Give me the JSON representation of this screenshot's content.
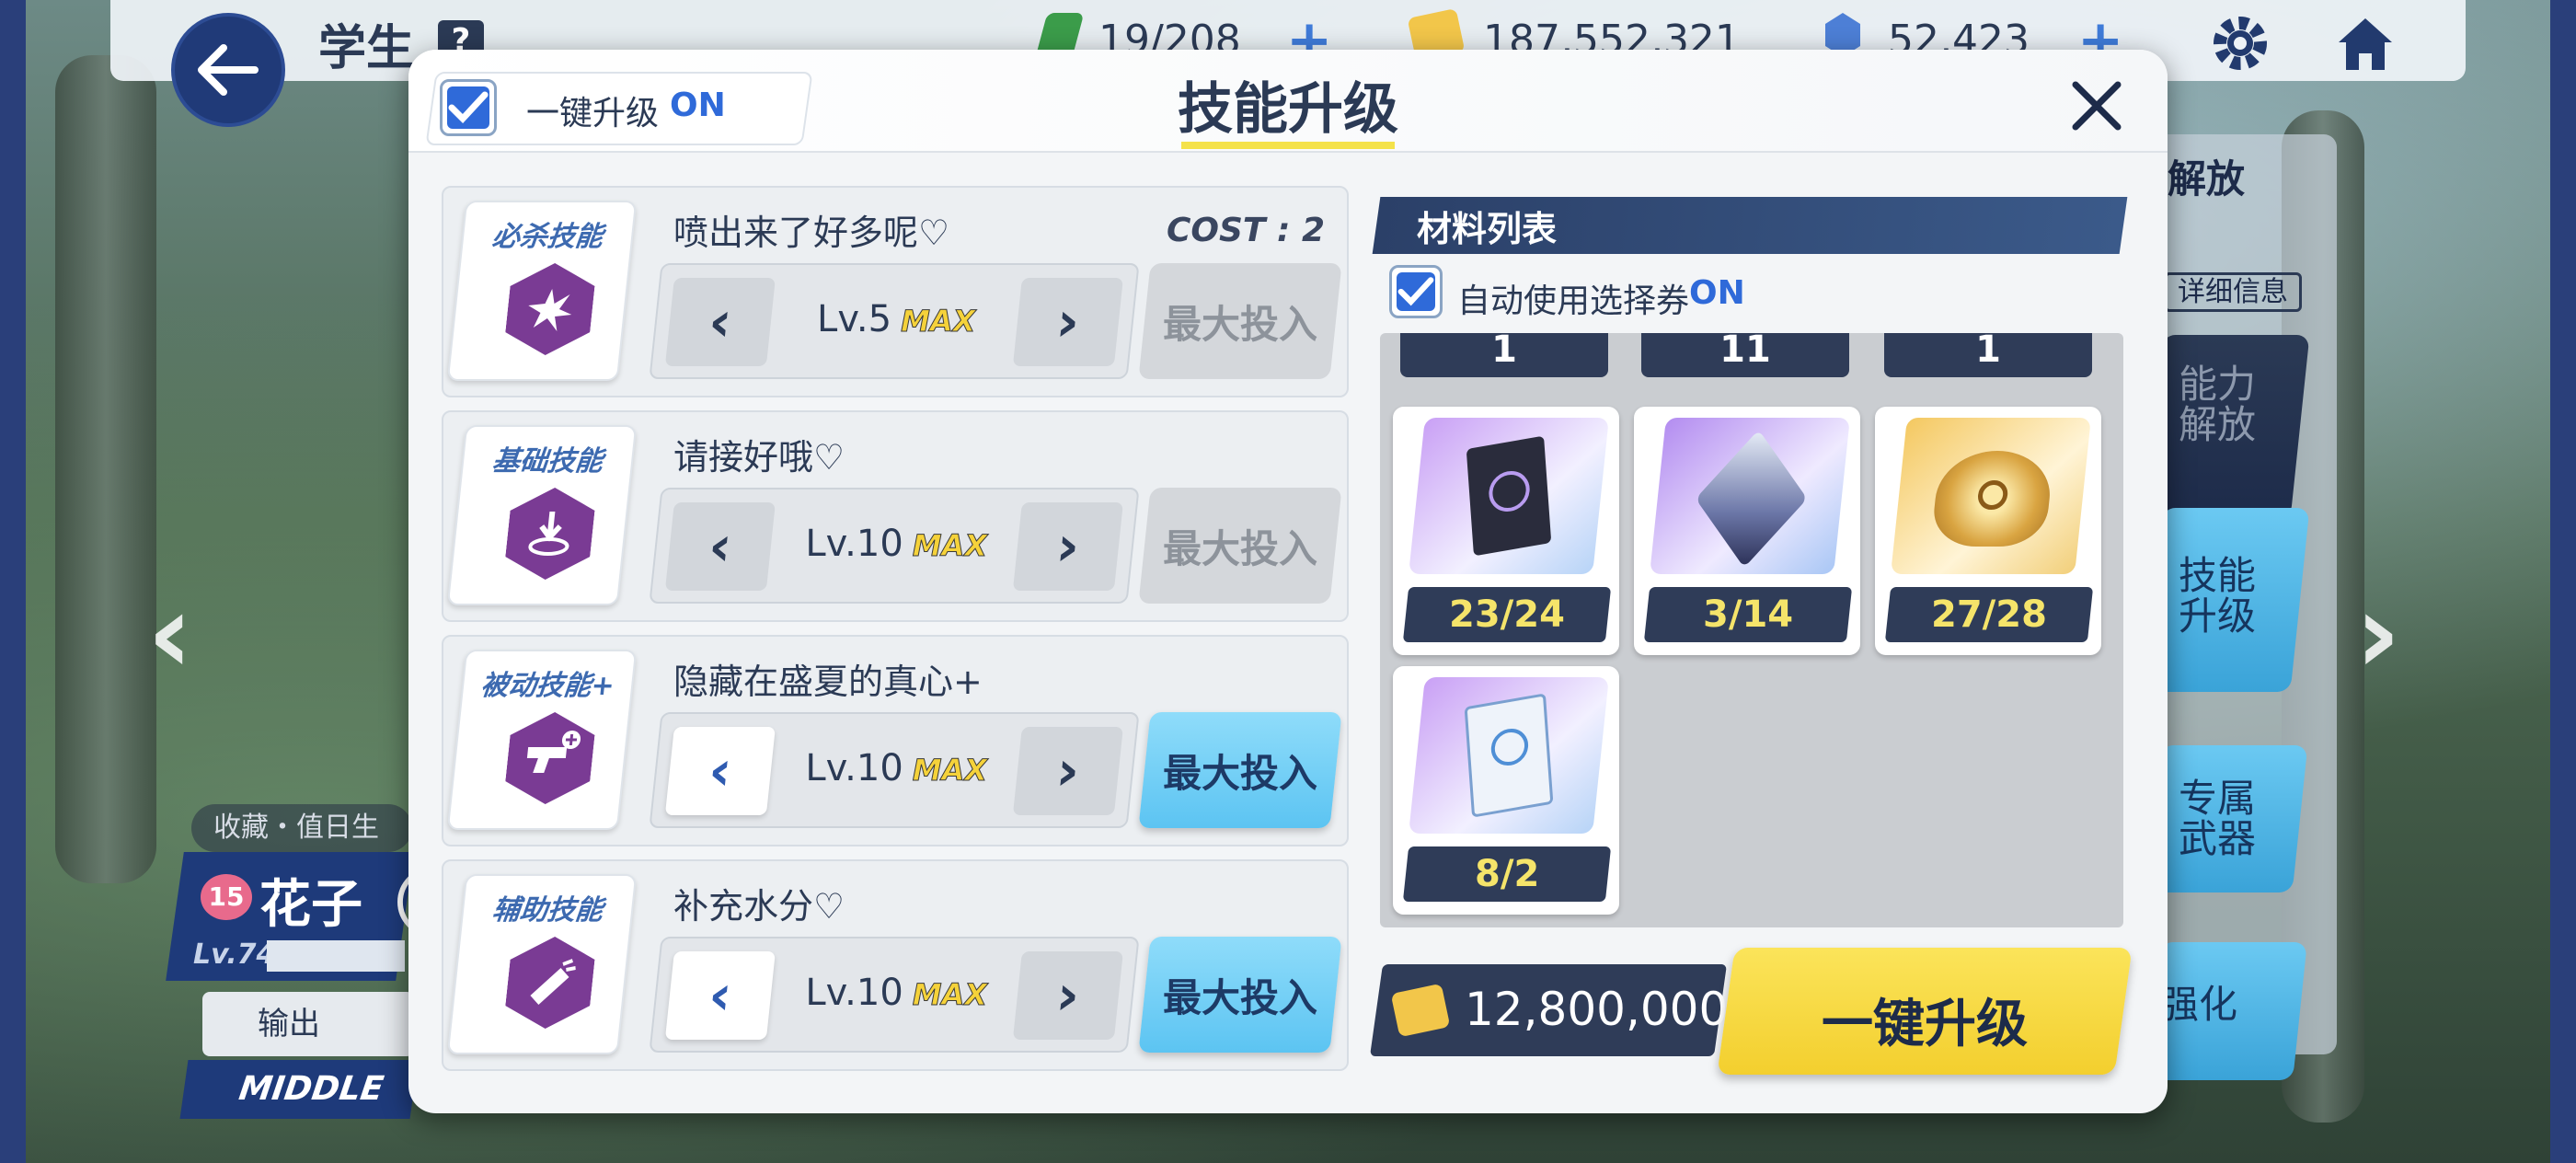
{
  "topbar": {
    "title": "学生",
    "help": "?",
    "ap": "19/208",
    "credits": "187,552,321",
    "gems": "52,423"
  },
  "side_menu": {
    "unlock_label": "解放",
    "detail_label": "详细信息",
    "ability_label": "能力解放",
    "skill_label": "技能升级",
    "weapon_label": "专属武器",
    "enhance_label": "强化"
  },
  "character": {
    "tag": "收藏・值日生",
    "bond": "15",
    "name": "花子（泳",
    "level": "Lv.74",
    "role": "输出",
    "position": "MIDDLE"
  },
  "dialog": {
    "title": "技能升级",
    "onekey_label": "一键升级",
    "onekey_state": "ON",
    "skills": [
      {
        "type": "必杀技能",
        "name": "喷出来了好多呢♡",
        "cost": "COST : 2",
        "level": "Lv.5",
        "max": "MAX",
        "button": "最大投入",
        "button_enabled": false
      },
      {
        "type": "基础技能",
        "name": "请接好哦♡",
        "level": "Lv.10",
        "max": "MAX",
        "button": "最大投入",
        "button_enabled": false
      },
      {
        "type": "被动技能+",
        "name": "隐藏在盛夏的真心+",
        "level": "Lv.10",
        "max": "MAX",
        "button": "最大投入",
        "button_enabled": true
      },
      {
        "type": "辅助技能",
        "name": "补充水分♡",
        "level": "Lv.10",
        "max": "MAX",
        "button": "最大投入",
        "button_enabled": true
      }
    ],
    "materials": {
      "title": "材料列表",
      "auto_label": "自动使用选择券",
      "auto_state": "ON",
      "top_row_counts": [
        "1",
        "11",
        "1"
      ],
      "items": [
        {
          "icon": "trinity-book-icon",
          "count": "23/24"
        },
        {
          "icon": "crystal-cube-icon",
          "count": "3/14"
        },
        {
          "icon": "golden-artifact-icon",
          "count": "27/28"
        },
        {
          "icon": "techne-notebook-icon",
          "count": "8/2"
        }
      ]
    },
    "cost": "12,800,000",
    "upgrade_button": "一键升级"
  },
  "colors": {
    "accent_blue": "#2f6ad9",
    "navy": "#2f3c58",
    "upgrade_yellow": "#f3cf2e",
    "max_button_blue": "#5cc4f2",
    "skill_purple": "#7a3b94"
  }
}
